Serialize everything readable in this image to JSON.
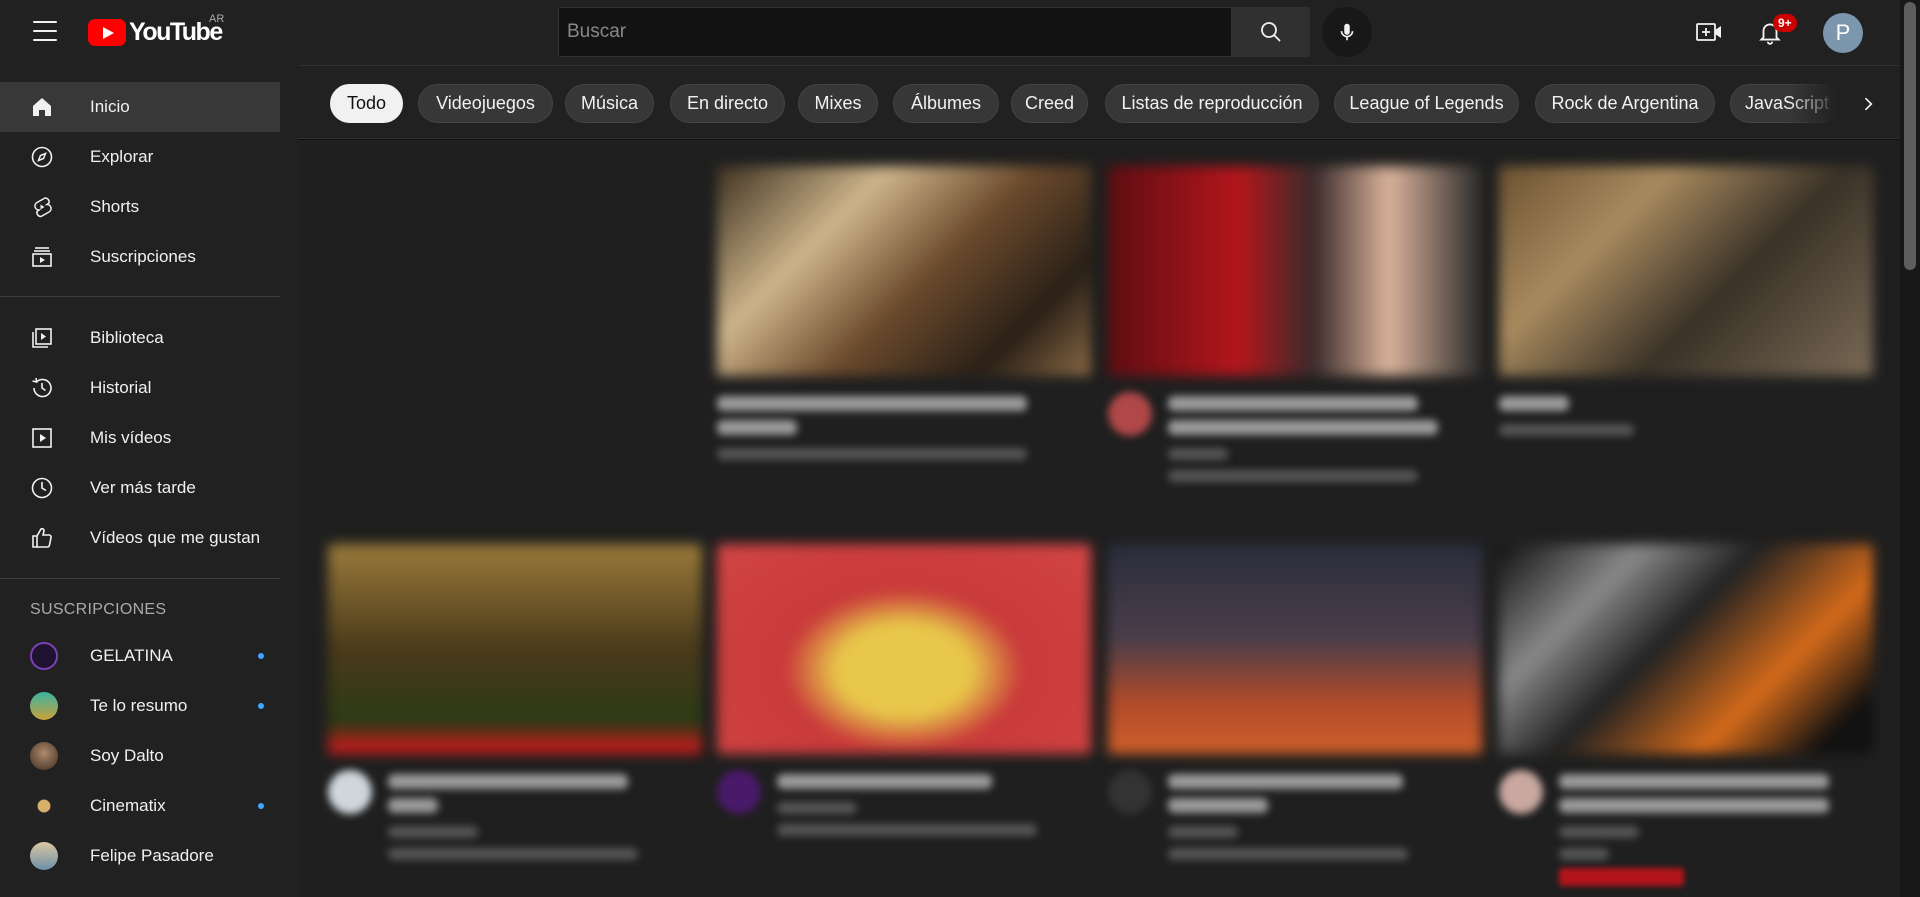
{
  "header": {
    "logo_text": "YouTube",
    "region": "AR",
    "search_placeholder": "Buscar",
    "notification_count": "9+",
    "avatar_initial": "P"
  },
  "sidebar": {
    "main": [
      {
        "label": "Inicio",
        "icon": "home-icon",
        "active": true
      },
      {
        "label": "Explorar",
        "icon": "compass-icon"
      },
      {
        "label": "Shorts",
        "icon": "shorts-icon"
      },
      {
        "label": "Suscripciones",
        "icon": "subscriptions-icon"
      }
    ],
    "library": [
      {
        "label": "Biblioteca",
        "icon": "library-icon"
      },
      {
        "label": "Historial",
        "icon": "history-icon"
      },
      {
        "label": "Mis vídeos",
        "icon": "my-videos-icon"
      },
      {
        "label": "Ver más tarde",
        "icon": "watch-later-icon"
      },
      {
        "label": "Vídeos que me gustan",
        "icon": "thumbs-up-icon"
      }
    ],
    "subscriptions_heading": "SUSCRIPCIONES",
    "subscriptions": [
      {
        "label": "GELATINA",
        "new": true,
        "color": "#5a2a86"
      },
      {
        "label": "Te lo resumo",
        "new": true,
        "color": "#2f9a8e"
      },
      {
        "label": "Soy Dalto",
        "new": false,
        "color": "#5b4a3e"
      },
      {
        "label": "Cinematix",
        "new": true,
        "color": "#2a2a2a"
      },
      {
        "label": "Felipe Pasadore",
        "new": false,
        "color": "#c8b89a"
      }
    ]
  },
  "chips": [
    "Todo",
    "Videojuegos",
    "Música",
    "En directo",
    "Mixes",
    "Álbumes",
    "Creed",
    "Listas de reproducción",
    "League of Legends",
    "Rock de Argentina",
    "JavaScript"
  ],
  "colors": {
    "brand_red": "#ff0000",
    "accent_blue": "#3ea6ff",
    "badge_red": "#cc0000"
  }
}
